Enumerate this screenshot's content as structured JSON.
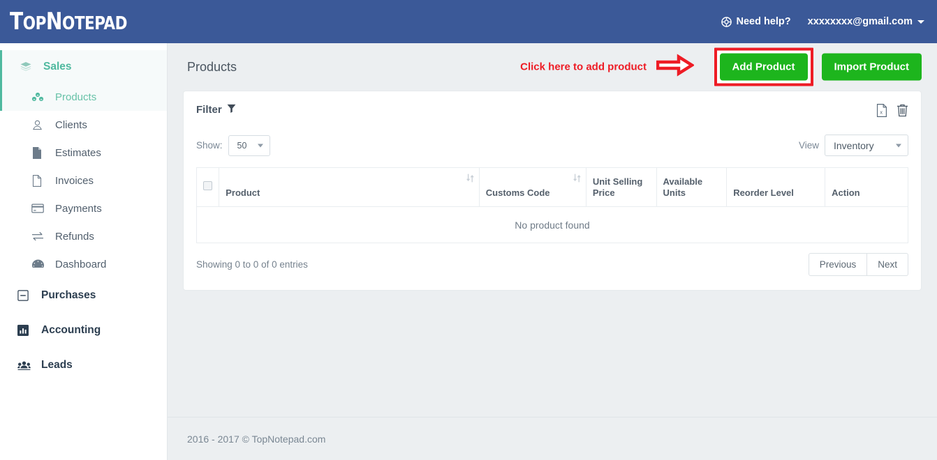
{
  "colors": {
    "header_blue": "#3b5998",
    "accent_green": "#4fb99f",
    "button_green": "#1db51d",
    "annotation_red": "#ee1c25",
    "page_bg": "#eceff1",
    "text_dark": "#2c3e50"
  },
  "header": {
    "brand": "TopNotepad",
    "brand_parts": {
      "t": "T",
      "op": "OP",
      "n": "N",
      "otepad": "OTEPAD"
    },
    "need_help_label": "Need help?",
    "need_help_icon": "lifebuoy-icon",
    "user_email": "xxxxxxxx@gmail.com",
    "user_caret_icon": "caret-down-icon"
  },
  "sidebar": {
    "items": [
      {
        "label": "Sales",
        "icon": "layers-icon",
        "type": "group",
        "active": true
      },
      {
        "label": "Products",
        "icon": "products-icon",
        "type": "sub",
        "active": true
      },
      {
        "label": "Clients",
        "icon": "user-icon",
        "type": "sub",
        "active": false
      },
      {
        "label": "Estimates",
        "icon": "file-filled-icon",
        "type": "sub",
        "active": false
      },
      {
        "label": "Invoices",
        "icon": "file-icon",
        "type": "sub",
        "active": false
      },
      {
        "label": "Payments",
        "icon": "credit-card-icon",
        "type": "sub",
        "active": false
      },
      {
        "label": "Refunds",
        "icon": "exchange-icon",
        "type": "sub",
        "active": false
      },
      {
        "label": "Dashboard",
        "icon": "gauge-icon",
        "type": "sub",
        "active": false
      },
      {
        "label": "Purchases",
        "icon": "minus-square-icon",
        "type": "major",
        "active": false
      },
      {
        "label": "Accounting",
        "icon": "bar-chart-icon",
        "type": "major",
        "active": false
      },
      {
        "label": "Leads",
        "icon": "group-icon",
        "type": "major",
        "active": false
      }
    ]
  },
  "page": {
    "title": "Products",
    "annotation_text": "Click here to add product",
    "annotation_arrow_icon": "right-arrow-icon",
    "add_product_label": "Add Product",
    "import_product_label": "Import Product"
  },
  "filter_card": {
    "filter_label": "Filter",
    "filter_icon": "funnel-icon",
    "export_icon": "excel-export-icon",
    "delete_icon": "trash-icon",
    "show_label": "Show:",
    "show_value": "50",
    "view_label": "View",
    "view_value": "Inventory"
  },
  "table": {
    "select_all_checkbox": "",
    "columns": [
      {
        "label": "Product",
        "sortable": true,
        "sort_icon": "sort-icon"
      },
      {
        "label": "Customs Code",
        "sortable": true,
        "sort_icon": "sort-icon"
      },
      {
        "label": "Unit Selling\nPrice",
        "sortable": false,
        "line1": "Unit Selling",
        "line2": "Price"
      },
      {
        "label": "Available\nUnits",
        "sortable": false,
        "line1": "Available",
        "line2": "Units"
      },
      {
        "label": "Reorder Level",
        "sortable": false
      },
      {
        "label": "Action",
        "sortable": false
      }
    ],
    "empty_message": "No product found",
    "rows": [],
    "entries_info": "Showing 0 to 0 of 0 entries",
    "pagination": {
      "previous_label": "Previous",
      "next_label": "Next"
    }
  },
  "footer": {
    "copyright": "2016 - 2017 © TopNotepad.com"
  }
}
